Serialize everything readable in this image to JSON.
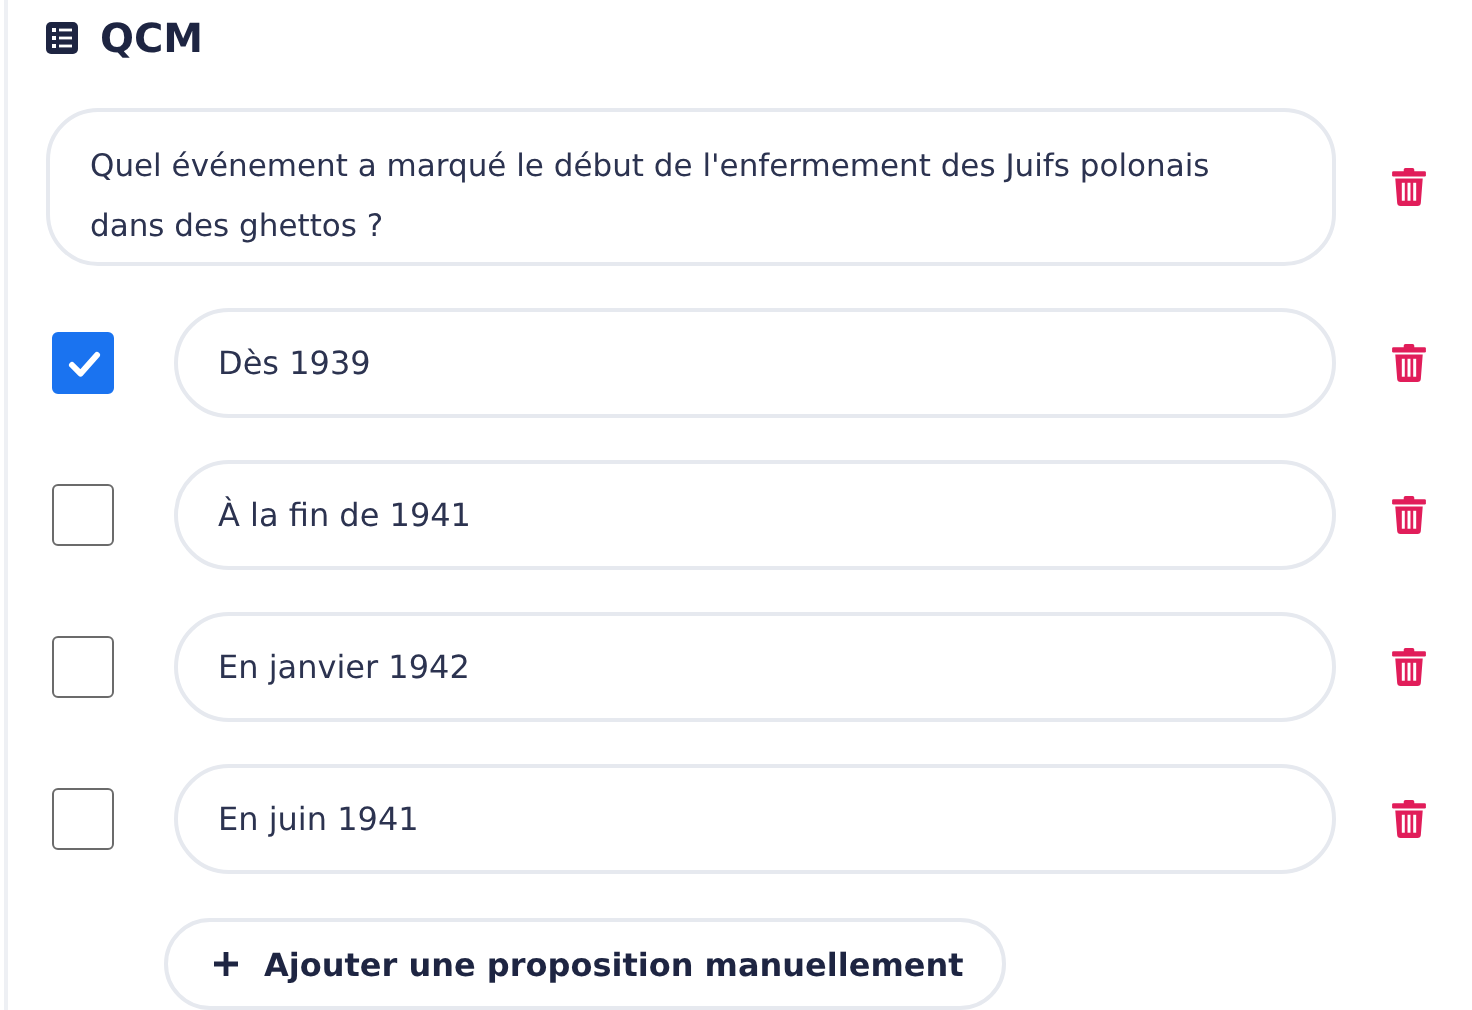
{
  "section": {
    "title": "QCM"
  },
  "question": {
    "value": "Quel événement a marqué le début de l'enfermement des Juifs polonais dans des ghettos ?"
  },
  "options": [
    {
      "value": "Dès 1939",
      "checked": true
    },
    {
      "value": "À la fin de 1941",
      "checked": false
    },
    {
      "value": "En janvier 1942",
      "checked": false
    },
    {
      "value": "En juin 1941",
      "checked": false
    }
  ],
  "add_button": {
    "label": "Ajouter une proposition manuellement"
  }
}
